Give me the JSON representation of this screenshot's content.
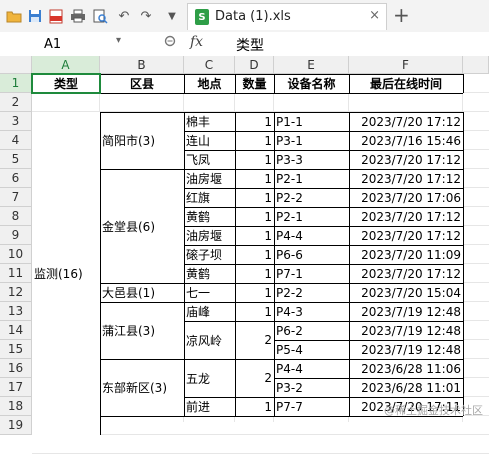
{
  "tab": {
    "title": "Data (1).xls",
    "file_icon": "S",
    "close_glyph": "×",
    "new_glyph": "+"
  },
  "formula": {
    "cell_ref": "A1",
    "fx_label": "fx",
    "value": "类型"
  },
  "columns": [
    "A",
    "B",
    "C",
    "D",
    "E",
    "F"
  ],
  "rows": [
    "1",
    "2",
    "3",
    "4",
    "5",
    "6",
    "7",
    "8",
    "9",
    "10",
    "11",
    "12",
    "13",
    "14",
    "15",
    "16",
    "17",
    "18",
    "19"
  ],
  "header": [
    "类型",
    "区县",
    "地点",
    "数量",
    "设备名称",
    "最后在线时间"
  ],
  "category": "监测(16)",
  "districts": [
    {
      "name": "简阳市(3)"
    },
    {
      "name": "金堂县(6)"
    },
    {
      "name": "大邑县(1)"
    },
    {
      "name": "蒲江县(3)"
    },
    {
      "name": "东部新区(3)"
    }
  ],
  "locations": [
    {
      "name": "棉丰",
      "count": "1"
    },
    {
      "name": "连山",
      "count": "1"
    },
    {
      "name": "飞凤",
      "count": "1"
    },
    {
      "name": "油房堰",
      "count": "1"
    },
    {
      "name": "红旗",
      "count": "1"
    },
    {
      "name": "黄鹤",
      "count": "1"
    },
    {
      "name": "油房堰",
      "count": "1"
    },
    {
      "name": "磙子坝",
      "count": "1"
    },
    {
      "name": "黄鹤",
      "count": "1"
    },
    {
      "name": "七一",
      "count": "1"
    },
    {
      "name": "庙峰",
      "count": "1"
    },
    {
      "name": "凉风岭",
      "count": "2"
    },
    {
      "name": "五龙",
      "count": "2"
    },
    {
      "name": "前进",
      "count": "1"
    }
  ],
  "devices": [
    {
      "name": "P1-1",
      "time": "2023/7/20  17:12"
    },
    {
      "name": "P3-1",
      "time": "2023/7/16  15:46"
    },
    {
      "name": "P3-3",
      "time": "2023/7/20  17:12"
    },
    {
      "name": "P2-1",
      "time": "2023/7/20  17:12"
    },
    {
      "name": "P2-2",
      "time": "2023/7/20  17:06"
    },
    {
      "name": "P2-1",
      "time": "2023/7/20  17:12"
    },
    {
      "name": "P4-4",
      "time": "2023/7/20  17:12"
    },
    {
      "name": "P6-6",
      "time": "2023/7/20  11:09"
    },
    {
      "name": "P7-1",
      "time": "2023/7/20  17:12"
    },
    {
      "name": "P2-2",
      "time": "2023/7/20  15:04"
    },
    {
      "name": "P4-3",
      "time": "2023/7/19  12:48"
    },
    {
      "name": "P6-2",
      "time": "2023/7/19  12:48"
    },
    {
      "name": "P5-4",
      "time": "2023/7/19  12:48"
    },
    {
      "name": "P4-4",
      "time": "2023/6/28  11:06"
    },
    {
      "name": "P3-2",
      "time": "2023/6/28  11:01"
    },
    {
      "name": "P7-7",
      "time": "2023/7/20  17:11"
    }
  ],
  "watermark": "@稀土掘金技术社区"
}
